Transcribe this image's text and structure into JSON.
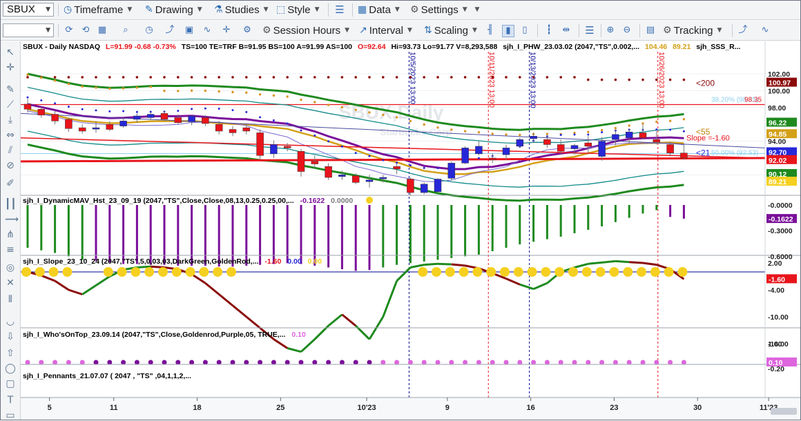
{
  "toolbar1": {
    "symbol": "SBUX",
    "timeframe": "Timeframe",
    "drawing": "Drawing",
    "studies": "Studies",
    "style": "Style",
    "data": "Data",
    "settings": "Settings"
  },
  "toolbar2": {
    "session_hours": "Session Hours",
    "interval": "Interval",
    "scaling": "Scaling",
    "tracking": "Tracking"
  },
  "colors": {
    "green": "#1e8a1e",
    "teal": "#128a8a",
    "purple": "#7a0f9a",
    "gold": "#d4a017",
    "red": "#e8141b",
    "blue": "#2727d8",
    "maroon": "#8b0a0a",
    "orange": "#d99423",
    "pink": "#dd66dd",
    "yellow": "#f5d020",
    "navy": "#000090"
  },
  "price_panel": {
    "header": {
      "a": "SBUX - Daily  NASDAQ",
      "b": "L=91.99  -0.68  -0.73%",
      "c": "TS=100  TE=TRF  B=91.95  BS=100  A=91.99  AS=100",
      "d": "O=92.64",
      "e": "Hi=93.73  Lo=91.77  V=8,293,588",
      "f": "sjh_I_PHW_23.03.02 (2047,\"TS\",0.002,...",
      "g": "104.46",
      "h": "89.21",
      "i": "sjh_SSS_R..."
    },
    "watermark_title": "SBUX,Daily",
    "watermark_sub": "Starbucks Corp",
    "vlines": [
      {
        "label": "10/5/2023 13:00",
        "color": "#000090"
      },
      {
        "label": "10/11/2023 13:00",
        "color": "#e8141b"
      },
      {
        "label": "10/13/2023 13:00",
        "color": "#000090"
      },
      {
        "label": "10/26/2023 13:00",
        "color": "#e8141b"
      }
    ],
    "annotations": {
      "lt200": "<200",
      "lt55": "<55",
      "lt21": "<21",
      "slope": "Slope =-1.60",
      "fib38": "38.20% (98.35)",
      "fib50": "50.00% (92.53)",
      "fib38_price": "98.35"
    },
    "axis_ticks": [
      "102.00",
      "100.00",
      "98.00",
      "94.00",
      "90.00"
    ],
    "badges": [
      {
        "text": "100.97",
        "bg": "#8b0a0a",
        "fg": "#ffffff"
      },
      {
        "text": "96.22",
        "bg": "#1e8a1e",
        "fg": "#ffffff"
      },
      {
        "text": "94.85",
        "bg": "#d4a017",
        "fg": "#ffffff"
      },
      {
        "text": "92.70",
        "bg": "#2727d8",
        "fg": "#ffffff"
      },
      {
        "text": "92.02",
        "bg": "#e8141b",
        "fg": "#ffffff"
      },
      {
        "text": "90.12",
        "bg": "#1e8a1e",
        "fg": "#ffffff"
      },
      {
        "text": "89.21",
        "bg": "#f5d020",
        "fg": "#ffffff"
      }
    ]
  },
  "mav_panel": {
    "header": "sjh_I_DynamicMAV_Hst_23_09_19 (2047,\"TS\",Close,Close,08,13,0.25,0.25,00,...",
    "v1": "-0.1622",
    "v2": "0.0000",
    "axis_ticks": [
      "-0.0000",
      "-0.3000",
      "-0.6000"
    ],
    "badge": "-0.1622",
    "values": [
      -0.5,
      -0.53,
      -0.56,
      -0.6,
      -0.64,
      -0.65,
      -0.67,
      -0.69,
      -0.69,
      -0.7,
      -0.7,
      -0.71,
      -0.71,
      -0.71,
      -0.72,
      -0.72,
      -0.71,
      -0.7,
      -0.69,
      -0.68,
      -0.69,
      -0.71,
      -0.73,
      -0.75,
      -0.77,
      -0.76,
      -0.73,
      -0.7,
      -0.68,
      -0.66,
      -0.64,
      -0.62,
      -0.6,
      -0.58,
      -0.54,
      -0.5,
      -0.46,
      -0.43,
      -0.4,
      -0.37,
      -0.33,
      -0.29,
      -0.25,
      -0.2,
      -0.15,
      -0.1,
      -0.06,
      -0.14,
      -0.16
    ],
    "bar_colors": [
      "g",
      "g",
      "g",
      "g",
      "g",
      "p",
      "p",
      "p",
      "p",
      "p",
      "p",
      "p",
      "p",
      "p",
      "p",
      "p",
      "p",
      "p",
      "p",
      "p",
      "p",
      "p",
      "p",
      "p",
      "p",
      "p",
      "g",
      "g",
      "g",
      "g",
      "g",
      "g",
      "g",
      "g",
      "g",
      "g",
      "g",
      "g",
      "g",
      "g",
      "g",
      "g",
      "g",
      "g",
      "g",
      "g",
      "g",
      "p",
      "p"
    ]
  },
  "slope_panel": {
    "header": "sjh_I_Slope_23_10_24 (2047,\"TS\",5,0,03,03,DarkGreen,GoldenRod,...",
    "v1": "-1.60",
    "v2": "0.00",
    "v3": "0.00",
    "axis_ticks": [
      "2.00",
      "-4.00",
      "-10.00",
      "-16.00"
    ],
    "badge": "-1.60",
    "values": [
      0.0,
      -0.8,
      -2.0,
      -4.0,
      -5.0,
      -3.0,
      -1.0,
      0.5,
      1.0,
      1.2,
      1.0,
      0.6,
      -0.5,
      -2.5,
      -5.0,
      -7.5,
      -10.0,
      -12.5,
      -15.0,
      -17.0,
      -17.8,
      -15.0,
      -12.0,
      -9.5,
      -12.0,
      -15.0,
      -10.0,
      -2.0,
      1.0,
      1.6,
      1.8,
      1.7,
      1.4,
      0.8,
      -0.3,
      -1.5,
      -2.8,
      -3.8,
      -2.5,
      0.0,
      1.0,
      1.8,
      2.1,
      2.4,
      2.2,
      2.0,
      1.6,
      0.6,
      -1.6
    ],
    "line_colors": [
      "m",
      "m",
      "m",
      "m",
      "m",
      "g",
      "g",
      "g",
      "g",
      "g",
      "m",
      "m",
      "m",
      "m",
      "m",
      "m",
      "m",
      "m",
      "m",
      "m",
      "g",
      "g",
      "g",
      "g",
      "m",
      "g",
      "g",
      "g",
      "g",
      "g",
      "g",
      "g",
      "m",
      "m",
      "m",
      "m",
      "m",
      "g",
      "g",
      "g",
      "g",
      "g",
      "g",
      "g",
      "g",
      "m",
      "m",
      "m",
      "m"
    ],
    "dots": [
      0,
      1,
      2,
      3,
      6,
      7,
      8,
      9,
      10,
      11,
      12,
      13,
      14,
      15,
      29,
      30,
      31,
      32,
      33,
      34,
      35,
      36,
      37,
      38,
      39,
      40,
      41,
      42,
      43,
      44,
      45,
      46,
      47,
      48
    ]
  },
  "who_panel": {
    "header": "sjh_I_Who'sOnTop_23.09.14 (2047,\"TS\",Close,Goldenrod,Purple,05,  TRUE,...",
    "v1": "0.10",
    "axis_ticks": [
      "1.00",
      "-0.20"
    ],
    "badge": "0.10",
    "dot_colors": [
      "pk",
      "pk",
      "pk",
      "pk",
      "pk",
      "pu",
      "pu",
      "pu",
      "pu",
      "pu",
      "pu",
      "pu",
      "pu",
      "pu",
      "pu",
      "pu",
      "pu",
      "pu",
      "pu",
      "pu",
      "pu",
      "pu",
      "pu",
      "pu",
      "pu",
      "pu",
      "pk",
      "pk",
      "pk",
      "pk",
      "pk",
      "pk",
      "pk",
      "pk",
      "pk",
      "pk",
      "pk",
      "pk",
      "pk",
      "pk",
      "pk",
      "pk",
      "pk",
      "pk",
      "pk",
      "pk",
      "pk",
      "pk",
      "pk"
    ]
  },
  "pennants_panel": {
    "header": "sjh_I_Pennants_21.07.07 (  2047 ,  \"TS\" ,04,1,1,2,..."
  },
  "x_axis": {
    "labels": [
      "5",
      "11",
      "18",
      "25",
      "10'23",
      "9",
      "16",
      "23",
      "30",
      "11'23"
    ]
  },
  "candles": [
    {
      "o": 98.4,
      "h": 99.0,
      "l": 97.4,
      "c": 97.8
    },
    {
      "o": 97.8,
      "h": 98.1,
      "l": 96.8,
      "c": 97.1
    },
    {
      "o": 97.2,
      "h": 97.6,
      "l": 96.0,
      "c": 96.4
    },
    {
      "o": 96.6,
      "h": 96.8,
      "l": 95.1,
      "c": 95.5
    },
    {
      "o": 95.6,
      "h": 96.0,
      "l": 94.9,
      "c": 95.2
    },
    {
      "o": 95.5,
      "h": 96.4,
      "l": 95.0,
      "c": 95.6
    },
    {
      "o": 96.0,
      "h": 96.4,
      "l": 95.2,
      "c": 95.4
    },
    {
      "o": 95.8,
      "h": 96.8,
      "l": 95.6,
      "c": 96.4
    },
    {
      "o": 96.6,
      "h": 97.3,
      "l": 96.2,
      "c": 97.0
    },
    {
      "o": 96.8,
      "h": 97.4,
      "l": 96.5,
      "c": 97.2
    },
    {
      "o": 97.3,
      "h": 97.6,
      "l": 96.4,
      "c": 96.6
    },
    {
      "o": 96.8,
      "h": 97.2,
      "l": 96.0,
      "c": 96.2
    },
    {
      "o": 96.3,
      "h": 97.1,
      "l": 95.9,
      "c": 97.0
    },
    {
      "o": 96.8,
      "h": 97.1,
      "l": 95.8,
      "c": 96.1
    },
    {
      "o": 96.0,
      "h": 96.4,
      "l": 94.8,
      "c": 95.2
    },
    {
      "o": 95.4,
      "h": 95.8,
      "l": 94.6,
      "c": 95.0
    },
    {
      "o": 95.6,
      "h": 96.0,
      "l": 94.8,
      "c": 95.2
    },
    {
      "o": 95.0,
      "h": 95.4,
      "l": 91.9,
      "c": 92.3
    },
    {
      "o": 92.5,
      "h": 94.1,
      "l": 92.0,
      "c": 93.6
    },
    {
      "o": 93.4,
      "h": 93.8,
      "l": 92.8,
      "c": 93.2
    },
    {
      "o": 92.8,
      "h": 93.1,
      "l": 89.8,
      "c": 90.4
    },
    {
      "o": 91.6,
      "h": 92.3,
      "l": 90.8,
      "c": 91.3
    },
    {
      "o": 91.0,
      "h": 91.4,
      "l": 89.4,
      "c": 89.7
    },
    {
      "o": 89.8,
      "h": 90.5,
      "l": 89.4,
      "c": 90.0
    },
    {
      "o": 89.9,
      "h": 90.2,
      "l": 88.9,
      "c": 89.1
    },
    {
      "o": 89.2,
      "h": 90.0,
      "l": 88.5,
      "c": 89.4
    },
    {
      "o": 89.6,
      "h": 90.0,
      "l": 89.1,
      "c": 89.7
    },
    {
      "o": 91.0,
      "h": 91.4,
      "l": 90.1,
      "c": 90.7
    },
    {
      "o": 89.5,
      "h": 89.7,
      "l": 87.6,
      "c": 87.9
    },
    {
      "o": 87.9,
      "h": 89.1,
      "l": 87.7,
      "c": 88.9
    },
    {
      "o": 88.0,
      "h": 89.6,
      "l": 87.9,
      "c": 89.5
    },
    {
      "o": 89.6,
      "h": 91.6,
      "l": 89.4,
      "c": 91.4
    },
    {
      "o": 91.4,
      "h": 93.4,
      "l": 91.3,
      "c": 93.2
    },
    {
      "o": 92.5,
      "h": 94.0,
      "l": 92.3,
      "c": 93.4
    },
    {
      "o": 92.0,
      "h": 92.6,
      "l": 91.4,
      "c": 91.8
    },
    {
      "o": 92.4,
      "h": 93.6,
      "l": 91.8,
      "c": 93.2
    },
    {
      "o": 93.4,
      "h": 94.4,
      "l": 93.2,
      "c": 94.2
    },
    {
      "o": 94.3,
      "h": 95.0,
      "l": 93.8,
      "c": 94.6
    },
    {
      "o": 94.2,
      "h": 94.6,
      "l": 93.2,
      "c": 93.6
    },
    {
      "o": 93.6,
      "h": 94.2,
      "l": 92.4,
      "c": 92.8
    },
    {
      "o": 93.1,
      "h": 93.7,
      "l": 92.4,
      "c": 93.5
    },
    {
      "o": 93.8,
      "h": 94.6,
      "l": 92.6,
      "c": 93.4
    },
    {
      "o": 92.2,
      "h": 94.5,
      "l": 91.7,
      "c": 94.0
    },
    {
      "o": 94.2,
      "h": 95.4,
      "l": 93.5,
      "c": 94.8
    },
    {
      "o": 94.4,
      "h": 95.5,
      "l": 93.8,
      "c": 95.1
    },
    {
      "o": 95.0,
      "h": 96.0,
      "l": 94.2,
      "c": 94.4
    },
    {
      "o": 94.2,
      "h": 95.2,
      "l": 93.6,
      "c": 93.9
    },
    {
      "o": 93.6,
      "h": 93.9,
      "l": 92.2,
      "c": 92.6
    },
    {
      "o": 92.6,
      "h": 93.7,
      "l": 91.8,
      "c": 92.0
    }
  ]
}
